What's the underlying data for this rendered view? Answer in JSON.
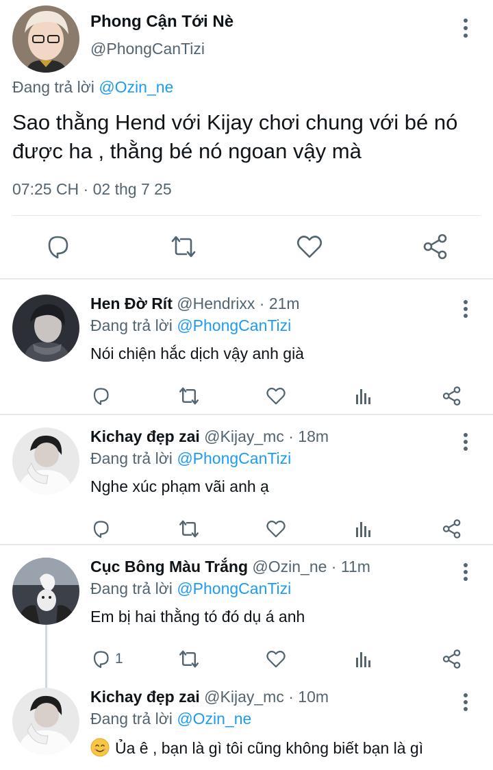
{
  "main_tweet": {
    "name": "Phong Cận Tới Nè",
    "handle": "@PhongCanTizi",
    "replying_prefix": "Đang trả lời",
    "replying_to": "@Ozin_ne",
    "text": "Sao thằng Hend với Kijay chơi chung với bé nó được ha , thằng bé nó ngoan vậy mà",
    "timestamp": "07:25 CH · 02 thg 7 25",
    "actions": [
      "reply-icon",
      "retweet-icon",
      "like-icon",
      "share-icon"
    ]
  },
  "replies": [
    {
      "name": "Hen Đờ Rít",
      "handle": "@Hendrixx",
      "time": "21m",
      "replying_prefix": "Đang trả lời",
      "replying_to": "@PhongCanTizi",
      "text": "Nói chiện hắc dịch vậy anh già",
      "reply_count": ""
    },
    {
      "name": "Kichay đẹp zai",
      "handle": "@Kijay_mc",
      "time": "18m",
      "replying_prefix": "Đang trả lời",
      "replying_to": "@PhongCanTizi",
      "text": "Nghe xúc phạm vãi anh ạ",
      "reply_count": ""
    },
    {
      "name": "Cục Bông Màu Trắng",
      "handle": "@Ozin_ne",
      "time": "11m",
      "replying_prefix": "Đang trả lời",
      "replying_to": "@PhongCanTizi",
      "text": "Em bị hai thằng tó đó dụ á anh",
      "reply_count": "1"
    },
    {
      "name": "Kichay đẹp zai",
      "handle": "@Kijay_mc",
      "time": "10m",
      "replying_prefix": "Đang trả lời",
      "replying_to": "@Ozin_ne",
      "text": "Ủa ê , bạn là gì tôi cũng không biết bạn là gì",
      "emoji": "smiling-face-emoji"
    }
  ],
  "colors": {
    "text": "#0f1419",
    "secondary": "#536471",
    "mention": "#1d9bf0",
    "divider": "#e6e9eb",
    "thread_line": "#cfd9de"
  }
}
